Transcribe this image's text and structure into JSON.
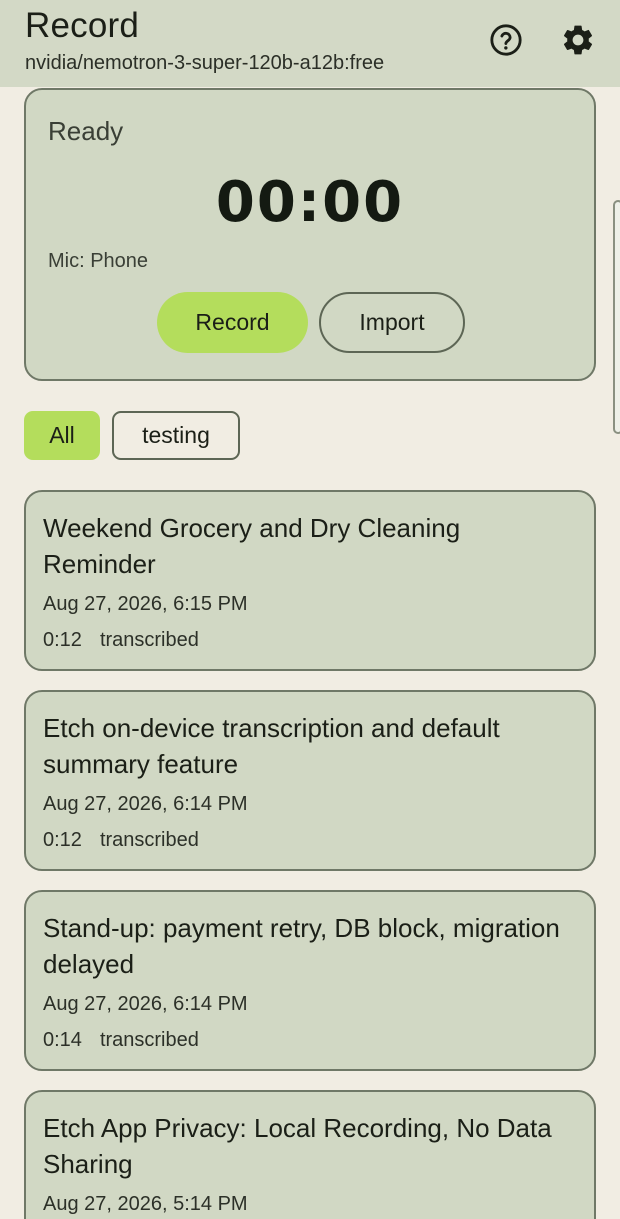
{
  "header": {
    "title": "Record",
    "model": "nvidia/nemotron-3-super-120b-a12b:free",
    "help_icon": "help-circle-icon",
    "settings_icon": "gear-icon"
  },
  "recorder": {
    "status": "Ready",
    "timer": "00:00",
    "mic": "Mic: Phone",
    "record_label": "Record",
    "import_label": "Import"
  },
  "filters": [
    {
      "label": "All",
      "selected": true
    },
    {
      "label": "testing",
      "selected": false
    }
  ],
  "recordings": [
    {
      "title": "Weekend Grocery and Dry Cleaning Reminder",
      "date": "Aug 27, 2026, 6:15 PM",
      "duration": "0:12",
      "status": "transcribed"
    },
    {
      "title": "Etch on-device transcription and default summary feature",
      "date": "Aug 27, 2026, 6:14 PM",
      "duration": "0:12",
      "status": "transcribed"
    },
    {
      "title": "Stand-up: payment retry, DB block, migration delayed",
      "date": "Aug 27, 2026, 6:14 PM",
      "duration": "0:14",
      "status": "transcribed"
    },
    {
      "title": "Etch App Privacy: Local Recording, No Data Sharing",
      "date": "Aug 27, 2026, 5:14 PM",
      "duration": "",
      "status": ""
    }
  ],
  "colors": {
    "background": "#f1ede3",
    "header": "#d3d9c6",
    "card": "#d1d8c4",
    "accent": "#b4dd5c",
    "border": "#6f7867"
  }
}
